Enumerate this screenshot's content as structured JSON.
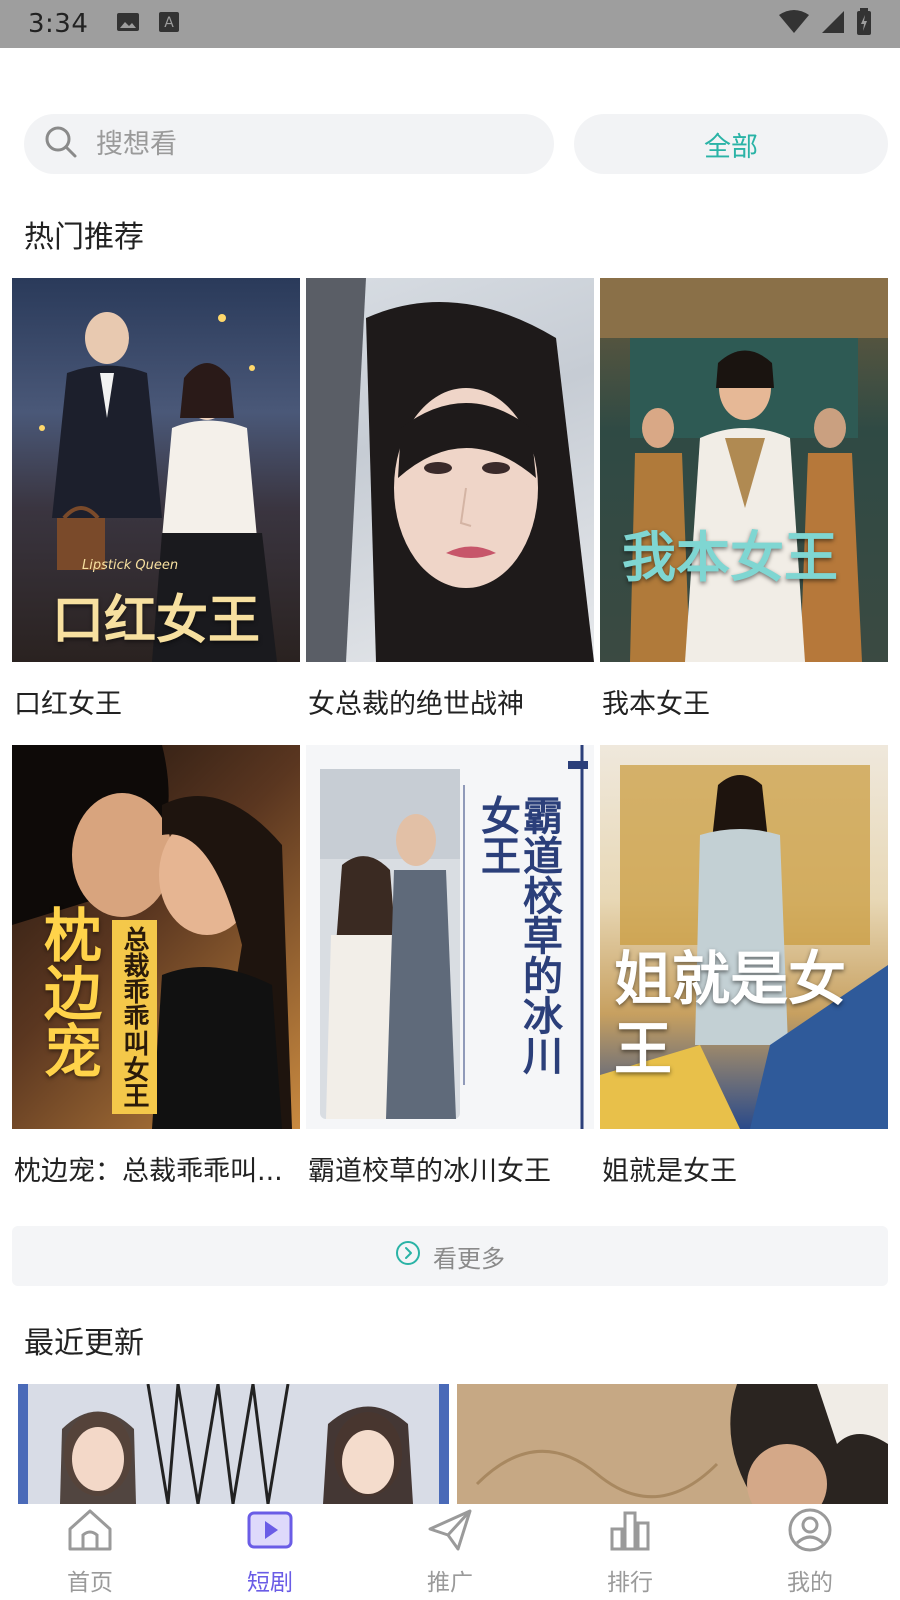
{
  "status_bar": {
    "time": "3:34"
  },
  "search": {
    "placeholder": "搜想看"
  },
  "filter_button": {
    "label": "全部"
  },
  "hot_section": {
    "title": "热门推荐",
    "items": [
      {
        "title": "口红女王",
        "poster_text": "口红女王",
        "poster_subtext": "Lipstick Queen"
      },
      {
        "title": "女总裁的绝世战神"
      },
      {
        "title": "我本女王",
        "poster_text": "我本女王"
      },
      {
        "title": "枕边宠：总裁乖乖叫...",
        "poster_text": "枕边宠",
        "poster_subtext": "总裁乖乖叫女王"
      },
      {
        "title": "霸道校草的冰川女王",
        "poster_text": "霸道校草的冰川女王"
      },
      {
        "title": "姐就是女王",
        "poster_text": "姐就是女王"
      }
    ]
  },
  "more_button": {
    "label": "看更多"
  },
  "recent_section": {
    "title": "最近更新"
  },
  "tab_bar": {
    "tabs": [
      {
        "label": "首页",
        "icon": "home-icon"
      },
      {
        "label": "短剧",
        "icon": "play-icon",
        "active": true
      },
      {
        "label": "推广",
        "icon": "send-icon"
      },
      {
        "label": "排行",
        "icon": "bar-chart-icon"
      },
      {
        "label": "我的",
        "icon": "user-icon"
      }
    ]
  },
  "colors": {
    "accent_teal": "#2ab3a6",
    "active_tab": "#6a5ce6"
  }
}
